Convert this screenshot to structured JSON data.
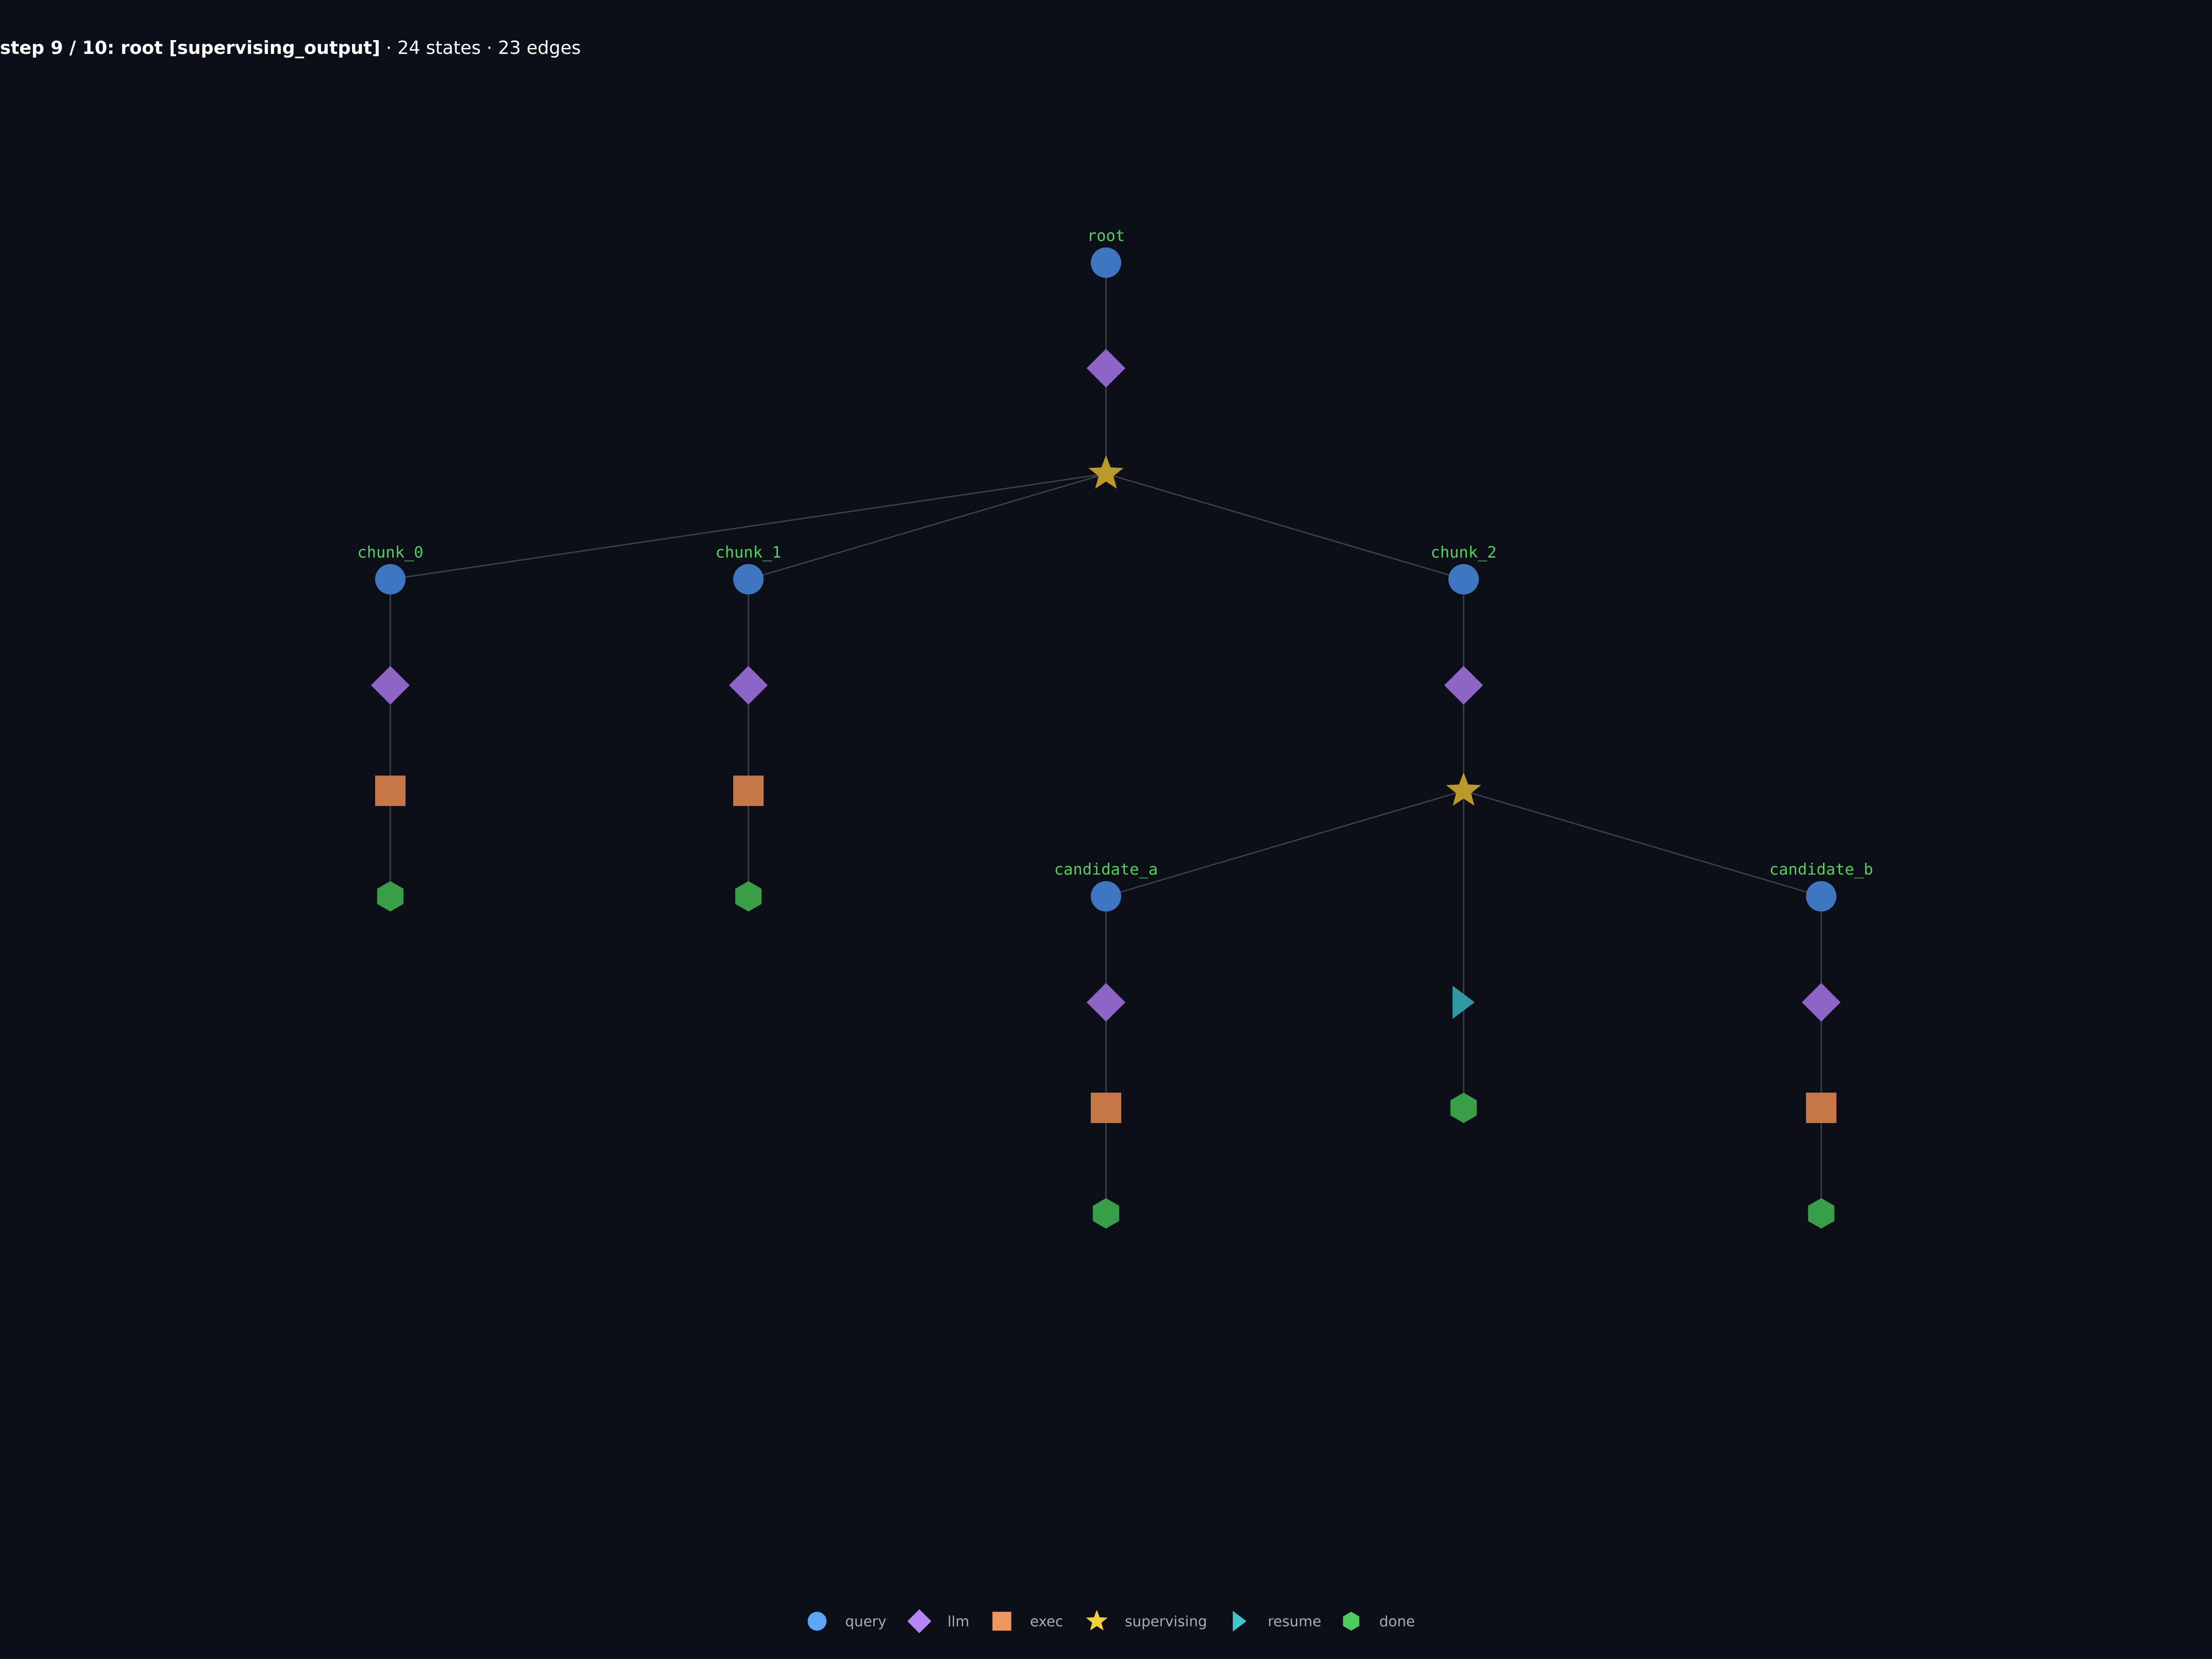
{
  "header": {
    "title_bold": "step 9 / 10: root [supervising_output]",
    "title_rest": " · 24 states · 23 edges"
  },
  "colors": {
    "background": "#0c0f17",
    "edge": "#3a3f49",
    "label": "#4fd35a",
    "query": "#3f76c1",
    "llm": "#8c65c7",
    "exec": "#c57748",
    "supervising": "#b99a2b",
    "resume": "#2f9aa6",
    "done": "#389e47"
  },
  "legend": {
    "items": [
      {
        "kind": "query",
        "label": "query",
        "icon": "circle-icon",
        "color": "#5aa7f5"
      },
      {
        "kind": "llm",
        "label": "llm",
        "icon": "diamond-icon",
        "color": "#b586f5"
      },
      {
        "kind": "exec",
        "label": "exec",
        "icon": "square-icon",
        "color": "#f2965f"
      },
      {
        "kind": "supervising",
        "label": "supervising",
        "icon": "star-icon",
        "color": "#f5ce3c"
      },
      {
        "kind": "resume",
        "label": "resume",
        "icon": "triangle-icon",
        "color": "#3fc6cf"
      },
      {
        "kind": "done",
        "label": "done",
        "icon": "hexagon-icon",
        "color": "#4fcc5e"
      }
    ]
  },
  "graph": {
    "nodes": [
      {
        "id": "root",
        "kind": "query",
        "label": "root"
      },
      {
        "id": "root_llm",
        "kind": "llm"
      },
      {
        "id": "root_sup",
        "kind": "supervising"
      },
      {
        "id": "chunk_0",
        "kind": "query",
        "label": "chunk_0"
      },
      {
        "id": "chunk_0_llm",
        "kind": "llm"
      },
      {
        "id": "chunk_0_exec",
        "kind": "exec"
      },
      {
        "id": "chunk_0_done",
        "kind": "done"
      },
      {
        "id": "chunk_1",
        "kind": "query",
        "label": "chunk_1"
      },
      {
        "id": "chunk_1_llm",
        "kind": "llm"
      },
      {
        "id": "chunk_1_exec",
        "kind": "exec"
      },
      {
        "id": "chunk_1_done",
        "kind": "done"
      },
      {
        "id": "chunk_2",
        "kind": "query",
        "label": "chunk_2"
      },
      {
        "id": "chunk_2_llm",
        "kind": "llm"
      },
      {
        "id": "chunk_2_sup",
        "kind": "supervising"
      },
      {
        "id": "chunk_2_resume",
        "kind": "resume"
      },
      {
        "id": "chunk_2_done",
        "kind": "done"
      },
      {
        "id": "candidate_a",
        "kind": "query",
        "label": "candidate_a"
      },
      {
        "id": "candidate_a_llm",
        "kind": "llm"
      },
      {
        "id": "candidate_a_exec",
        "kind": "exec"
      },
      {
        "id": "candidate_a_done",
        "kind": "done"
      },
      {
        "id": "candidate_b",
        "kind": "query",
        "label": "candidate_b"
      },
      {
        "id": "candidate_b_llm",
        "kind": "llm"
      },
      {
        "id": "candidate_b_exec",
        "kind": "exec"
      },
      {
        "id": "candidate_b_done",
        "kind": "done"
      }
    ],
    "edges": [
      [
        "root",
        "root_llm"
      ],
      [
        "root_llm",
        "root_sup"
      ],
      [
        "root_sup",
        "chunk_0"
      ],
      [
        "root_sup",
        "chunk_1"
      ],
      [
        "root_sup",
        "chunk_2"
      ],
      [
        "chunk_0",
        "chunk_0_llm"
      ],
      [
        "chunk_0_llm",
        "chunk_0_exec"
      ],
      [
        "chunk_0_exec",
        "chunk_0_done"
      ],
      [
        "chunk_1",
        "chunk_1_llm"
      ],
      [
        "chunk_1_llm",
        "chunk_1_exec"
      ],
      [
        "chunk_1_exec",
        "chunk_1_done"
      ],
      [
        "chunk_2",
        "chunk_2_llm"
      ],
      [
        "chunk_2_llm",
        "chunk_2_sup"
      ],
      [
        "chunk_2_sup",
        "candidate_a"
      ],
      [
        "chunk_2_sup",
        "chunk_2_resume"
      ],
      [
        "chunk_2_sup",
        "candidate_b"
      ],
      [
        "chunk_2_resume",
        "chunk_2_done"
      ],
      [
        "candidate_a",
        "candidate_a_llm"
      ],
      [
        "candidate_a_llm",
        "candidate_a_exec"
      ],
      [
        "candidate_a_exec",
        "candidate_a_done"
      ],
      [
        "candidate_b",
        "candidate_b_llm"
      ],
      [
        "candidate_b_llm",
        "candidate_b_exec"
      ],
      [
        "candidate_b_exec",
        "candidate_b_done"
      ]
    ]
  }
}
